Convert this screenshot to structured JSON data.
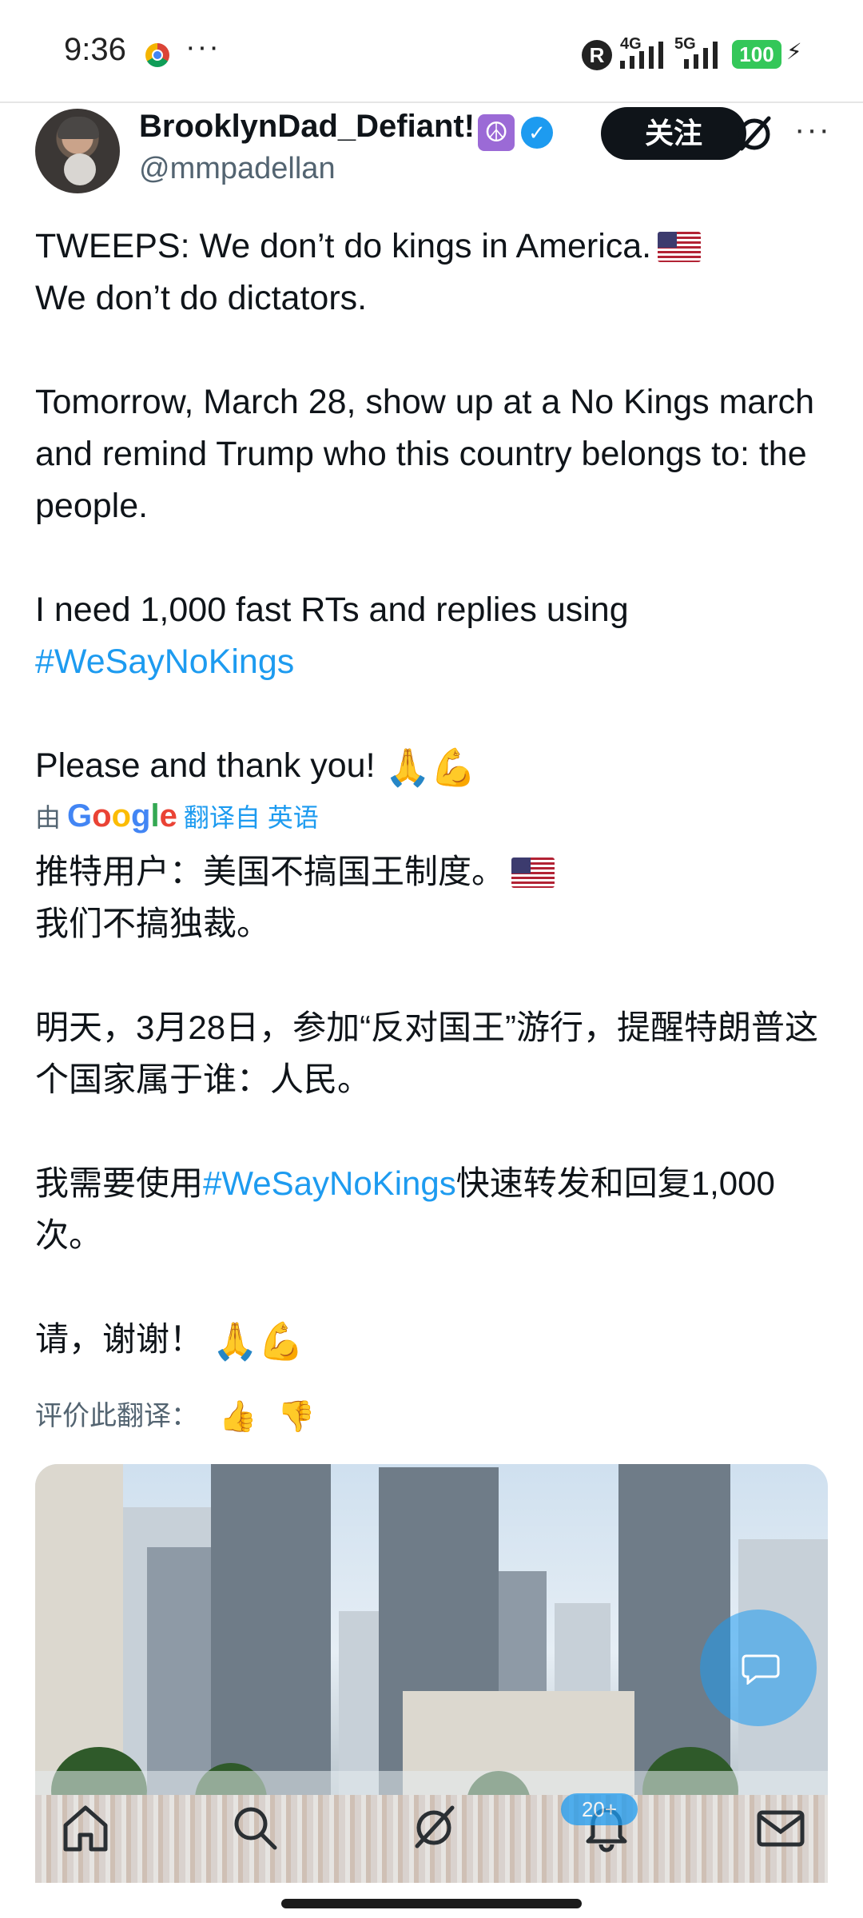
{
  "status_bar": {
    "time": "9:36",
    "overflow": "···",
    "roaming_badge": "R",
    "network_1": "4G",
    "network_2": "5G",
    "battery": "100"
  },
  "author": {
    "display_name": "BrooklynDad_Defiant!",
    "emoji_badge": "☮",
    "verified": "✓",
    "handle": "@mmpadellan",
    "follow_label": "关注"
  },
  "tweet": {
    "line1": "TWEEPS: We don’t do kings in America.",
    "line2": "We don’t do dictators.",
    "line3": "Tomorrow, March 28, show up at a No Kings march and remind Trump who this country belongs to: the people.",
    "line4": "I need 1,000 fast RTs and replies using",
    "hashtag": "#WeSayNoKings",
    "line5": "Please and thank you!",
    "emojis": "🙏💪"
  },
  "translation_source": {
    "prefix": "由",
    "google_letters": [
      "G",
      "o",
      "o",
      "g",
      "l",
      "e"
    ],
    "link": "翻译自 英语"
  },
  "translation": {
    "line1": "推特用户：美国不搞国王制度。",
    "line2": "我们不搞独裁。",
    "line3": "明天，3月28日，参加“反对国王”游行，提醒特朗普这个国家属于谁：人民。",
    "line4_pre": "我需要使用",
    "hashtag": "#WeSayNoKings",
    "line4_post": "快速转发和回复1,000 次。",
    "line5": "请，谢谢！",
    "emojis": "🙏💪"
  },
  "rate": {
    "label": "评价此翻译：",
    "thumbs_up": "👍",
    "thumbs_down": "👎"
  },
  "bottom_nav": {
    "notifications_badge": "20+",
    "items": [
      "home-icon",
      "search-icon",
      "grok-icon",
      "notifications-icon",
      "messages-icon"
    ]
  },
  "colors": {
    "accent": "#1d9bf0",
    "follow_button": "#0f1419",
    "secondary_text": "#536471"
  }
}
